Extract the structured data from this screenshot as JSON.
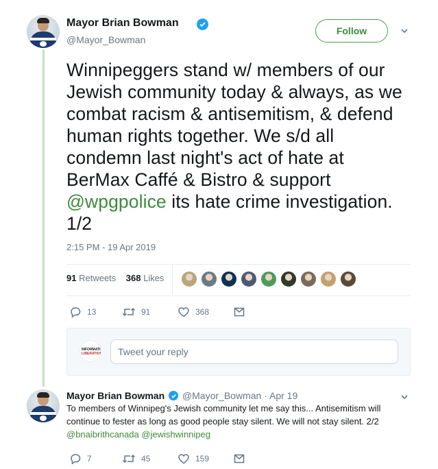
{
  "tweet1": {
    "author_name": "Mayor Brian Bowman",
    "author_handle": "@Mayor_Bowman",
    "follow_label": "Follow",
    "text_lines": [
      "Winnipeggers stand w/ members of our",
      "Jewish community today & always, as we",
      "combat racism & antisemitism, & defend",
      "human rights together. We s/d all",
      "condemn last night's act of hate at",
      "BerMax Caffé & Bistro & support"
    ],
    "text_mention": "@wpgpolice",
    "text_after_mention": " its hate crime investigation.",
    "text_last_line": "1/2",
    "timestamp": "2:15 PM - 19 Apr 2019",
    "retweets_count": "91",
    "retweets_label": "Retweets",
    "likes_count": "368",
    "likes_label": "Likes",
    "actions": {
      "replies": "13",
      "retweets": "91",
      "likes": "368"
    }
  },
  "reply_box": {
    "placeholder": "Tweet your reply",
    "avatar_text_top": "INFORMATION",
    "avatar_text_bottom": "LIBERATION"
  },
  "tweet2": {
    "author_name": "Mayor Brian Bowman",
    "author_handle": "@Mayor_Bowman",
    "separator": "·",
    "date": "Apr 19",
    "text_lines": [
      "To members of Winnipeg's Jewish community let me say this... Antisemitism will",
      "continue to fester as long as good people stay silent. We will not stay silent. 2/2"
    ],
    "mention1": "@bnaibrithcanada",
    "mention2": "@jewishwinnipeg",
    "actions": {
      "replies": "7",
      "retweets": "45",
      "likes": "159"
    }
  },
  "colors": {
    "accent_green": "#3d8a3a",
    "verified_blue": "#1da1f2",
    "muted": "#657786",
    "thread_line": "#c4e0c0"
  },
  "likers": [
    "#b9a67a",
    "#6b7a86",
    "#0f3057",
    "#4a5a78",
    "#4e9a5a",
    "#2f3a2a",
    "#7a6a5a",
    "#c2a070",
    "#5a4a3a"
  ]
}
